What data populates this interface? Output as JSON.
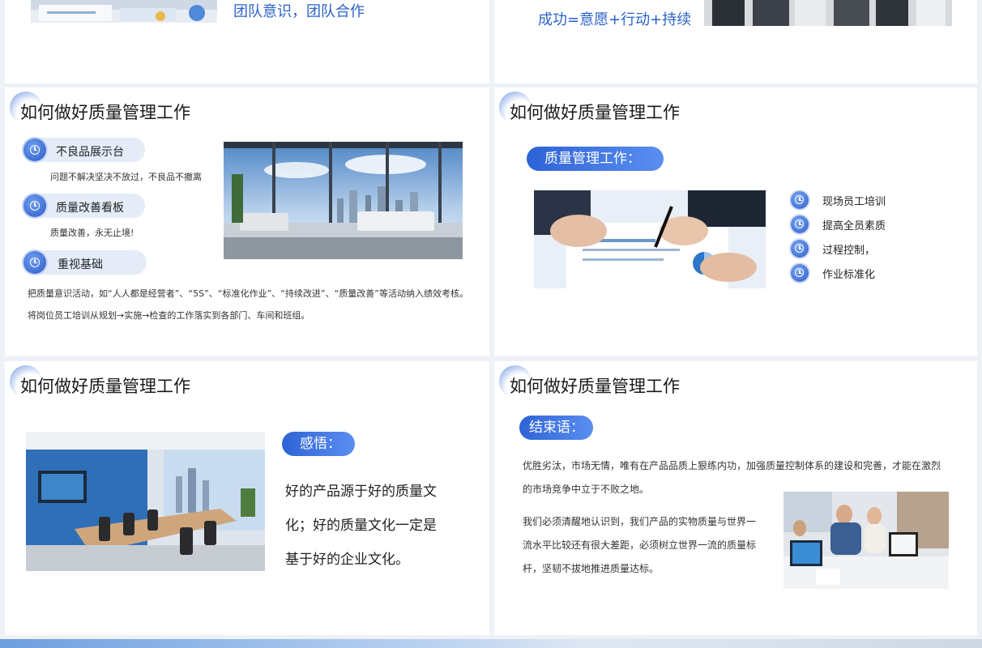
{
  "top_left": {
    "caption": "团队意识，团队合作"
  },
  "top_right": {
    "caption": "成功=意愿+行动+持续"
  },
  "slide3": {
    "title": "如何做好质量管理工作",
    "items": [
      {
        "label": "不良品展示台",
        "desc": "问题不解决坚决不放过，不良品不撤离"
      },
      {
        "label": "质量改善看板",
        "desc": "质量改善，永无止境!"
      },
      {
        "label": "重视基础",
        "desc": ""
      }
    ],
    "paragraph": "把质量意识活动，如“人人都是经营者”、“5S”、“标准化作业”、“持续改进”、“质量改善”等活动纳入绩效考核。将岗位员工培训从规划→实施→检查的工作落实到各部门、车间和班组。"
  },
  "slide4": {
    "title": "如何做好质量管理工作",
    "pill": "质量管理工作：",
    "items": [
      "现场员工培训",
      "提高全员素质",
      "过程控制，",
      "作业标准化"
    ]
  },
  "slide5": {
    "title": "如何做好质量管理工作",
    "pill": "感悟：",
    "lines": [
      "好的产品源于好的质量文",
      "化；好的质量文化一定是",
      "基于好的企业文化。"
    ]
  },
  "slide6": {
    "title": "如何做好质量管理工作",
    "pill": "结束语：",
    "para1": "优胜劣汰，市场无情，唯有在产品品质上狠练内功，加强质量控制体系的建设和完善，才能在激烈的市场竞争中立于不败之地。",
    "para2": "我们必须清醒地认识到，我们产品的实物质量与世界一流水平比较还有很大差距，必须树立世界一流的质量标杆，坚韧不拔地推进质量达标。"
  },
  "icons": {
    "bullet": "clock-icon",
    "title_decoration": "gradient-circle-icon"
  },
  "colors": {
    "accent_blue": "#2e63d6",
    "caption_blue": "#2a62c9",
    "background": "#eef1f6"
  }
}
